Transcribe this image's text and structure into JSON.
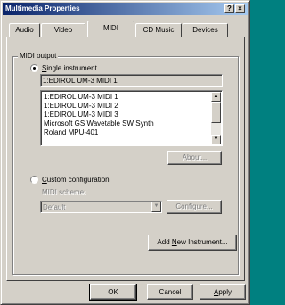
{
  "window": {
    "title": "Multimedia Properties",
    "help_glyph": "?",
    "close_glyph": "×"
  },
  "tabs": [
    {
      "label": "Audio"
    },
    {
      "label": "Video"
    },
    {
      "label": "MIDI",
      "active": true
    },
    {
      "label": "CD Music"
    },
    {
      "label": "Devices"
    }
  ],
  "midi_output": {
    "group_label": "MIDI output",
    "single_instrument": {
      "label_prefix": "",
      "label_hotkey": "S",
      "label_rest": "ingle instrument",
      "selected": true
    },
    "selected_instrument": "1:EDIROL UM-3 MIDI 1",
    "instruments": [
      "1:EDIROL UM-3 MIDI 1",
      "1:EDIROL UM-3 MIDI 2",
      "1:EDIROL UM-3 MIDI 3",
      "Microsoft GS Wavetable SW Synth",
      "Roland MPU-401"
    ],
    "about_button": "About...",
    "custom_configuration": {
      "label_hotkey": "C",
      "label_rest": "ustom configuration",
      "selected": false
    },
    "midi_scheme_label": "MIDI scheme:",
    "midi_scheme_value": "Default",
    "configure_button": "Configure...",
    "add_instrument": {
      "prefix": "Add ",
      "hotkey": "N",
      "rest": "ew Instrument..."
    }
  },
  "footer": {
    "ok": "OK",
    "cancel": "Cancel",
    "apply_hotkey": "A",
    "apply_rest": "pply"
  },
  "colors": {
    "face": "#d4d0c8",
    "title_start": "#0a246a",
    "title_end": "#a6caf0",
    "disabled": "#808080"
  }
}
